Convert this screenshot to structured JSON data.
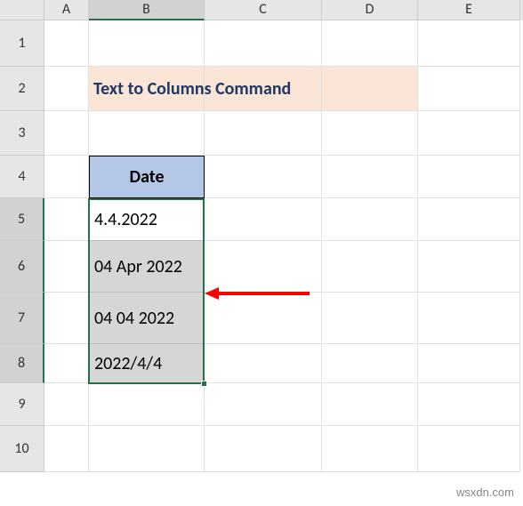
{
  "columns": [
    "A",
    "B",
    "C",
    "D",
    "E"
  ],
  "rows": [
    "1",
    "2",
    "3",
    "4",
    "5",
    "6",
    "7",
    "8",
    "9",
    "10"
  ],
  "title": "Text to Columns Command",
  "header": "Date",
  "dates": [
    "4.4.2022",
    "04 Apr 2022",
    "04 04 2022",
    "2022/4/4"
  ],
  "watermark": "wsxdn.com",
  "chart_data": {
    "type": "table",
    "title": "Date",
    "columns": [
      "Date"
    ],
    "rows": [
      [
        "4.4.2022"
      ],
      [
        "04 Apr 2022"
      ],
      [
        "04 04 2022"
      ],
      [
        "2022/4/4"
      ]
    ],
    "selection": "B5:B8",
    "active_cell": "B5"
  }
}
